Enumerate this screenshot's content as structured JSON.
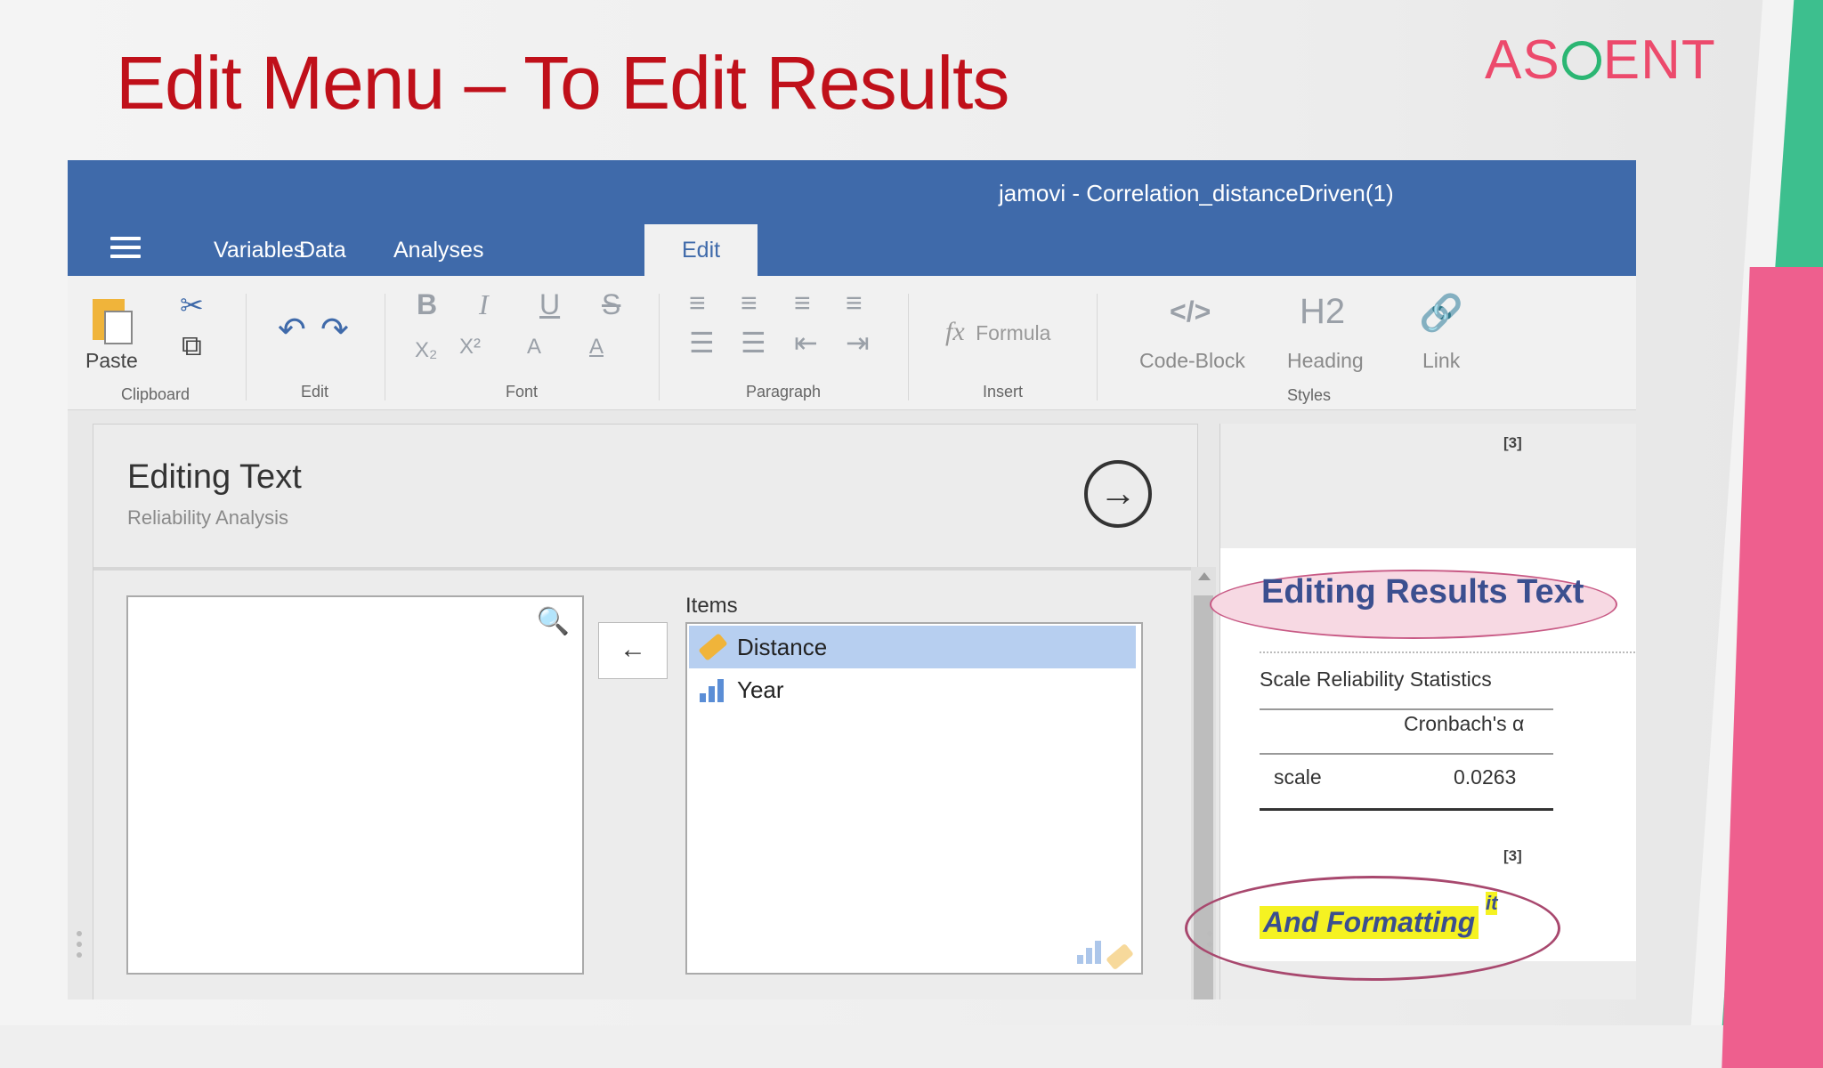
{
  "slide": {
    "title": "Edit Menu – To Edit Results",
    "logo": {
      "prefix": "AS",
      "suffix": "ENT",
      "colors": {
        "text": "#ec4a6c",
        "ring": "#2bb673"
      }
    }
  },
  "window": {
    "title": "jamovi - Correlation_distanceDriven(1)",
    "accent": "#3f6aaa"
  },
  "tabs": [
    {
      "label": "Variables"
    },
    {
      "label": "Data"
    },
    {
      "label": "Analyses"
    },
    {
      "label": "Edit",
      "active": true
    }
  ],
  "ribbon": {
    "paste_label": "Paste",
    "groups": {
      "clipboard": "Clipboard",
      "edit": "Edit",
      "font": "Font",
      "paragraph": "Paragraph",
      "insert": "Insert",
      "styles": "Styles"
    },
    "font_buttons": {
      "bold": "B",
      "italic": "I",
      "underline": "U",
      "strike": "S",
      "subscript": "X₂",
      "superscript": "X²",
      "highlight": "A",
      "color": "A"
    },
    "formula_icon": "fx",
    "formula_label": "Formula",
    "code_block_icon": "</>",
    "code_block_label": "Code-Block",
    "heading_icon": "H2",
    "heading_label": "Heading",
    "link_label": "Link"
  },
  "editor": {
    "title": "Editing Text",
    "subtitle": "Reliability Analysis",
    "items_label": "Items",
    "items": [
      {
        "name": "Distance",
        "icon": "ruler-icon",
        "selected": true
      },
      {
        "name": "Year",
        "icon": "bar-chart-icon",
        "selected": false
      }
    ]
  },
  "results": {
    "ref1": "[3]",
    "heading": "Editing Results Text",
    "table_title": "Scale Reliability Statistics",
    "col_header": "Cronbach's α",
    "row_label": "scale",
    "row_value": "0.0263",
    "ref2": "[3]",
    "formatted_text": "And Formatting",
    "superscript_text": "it"
  }
}
